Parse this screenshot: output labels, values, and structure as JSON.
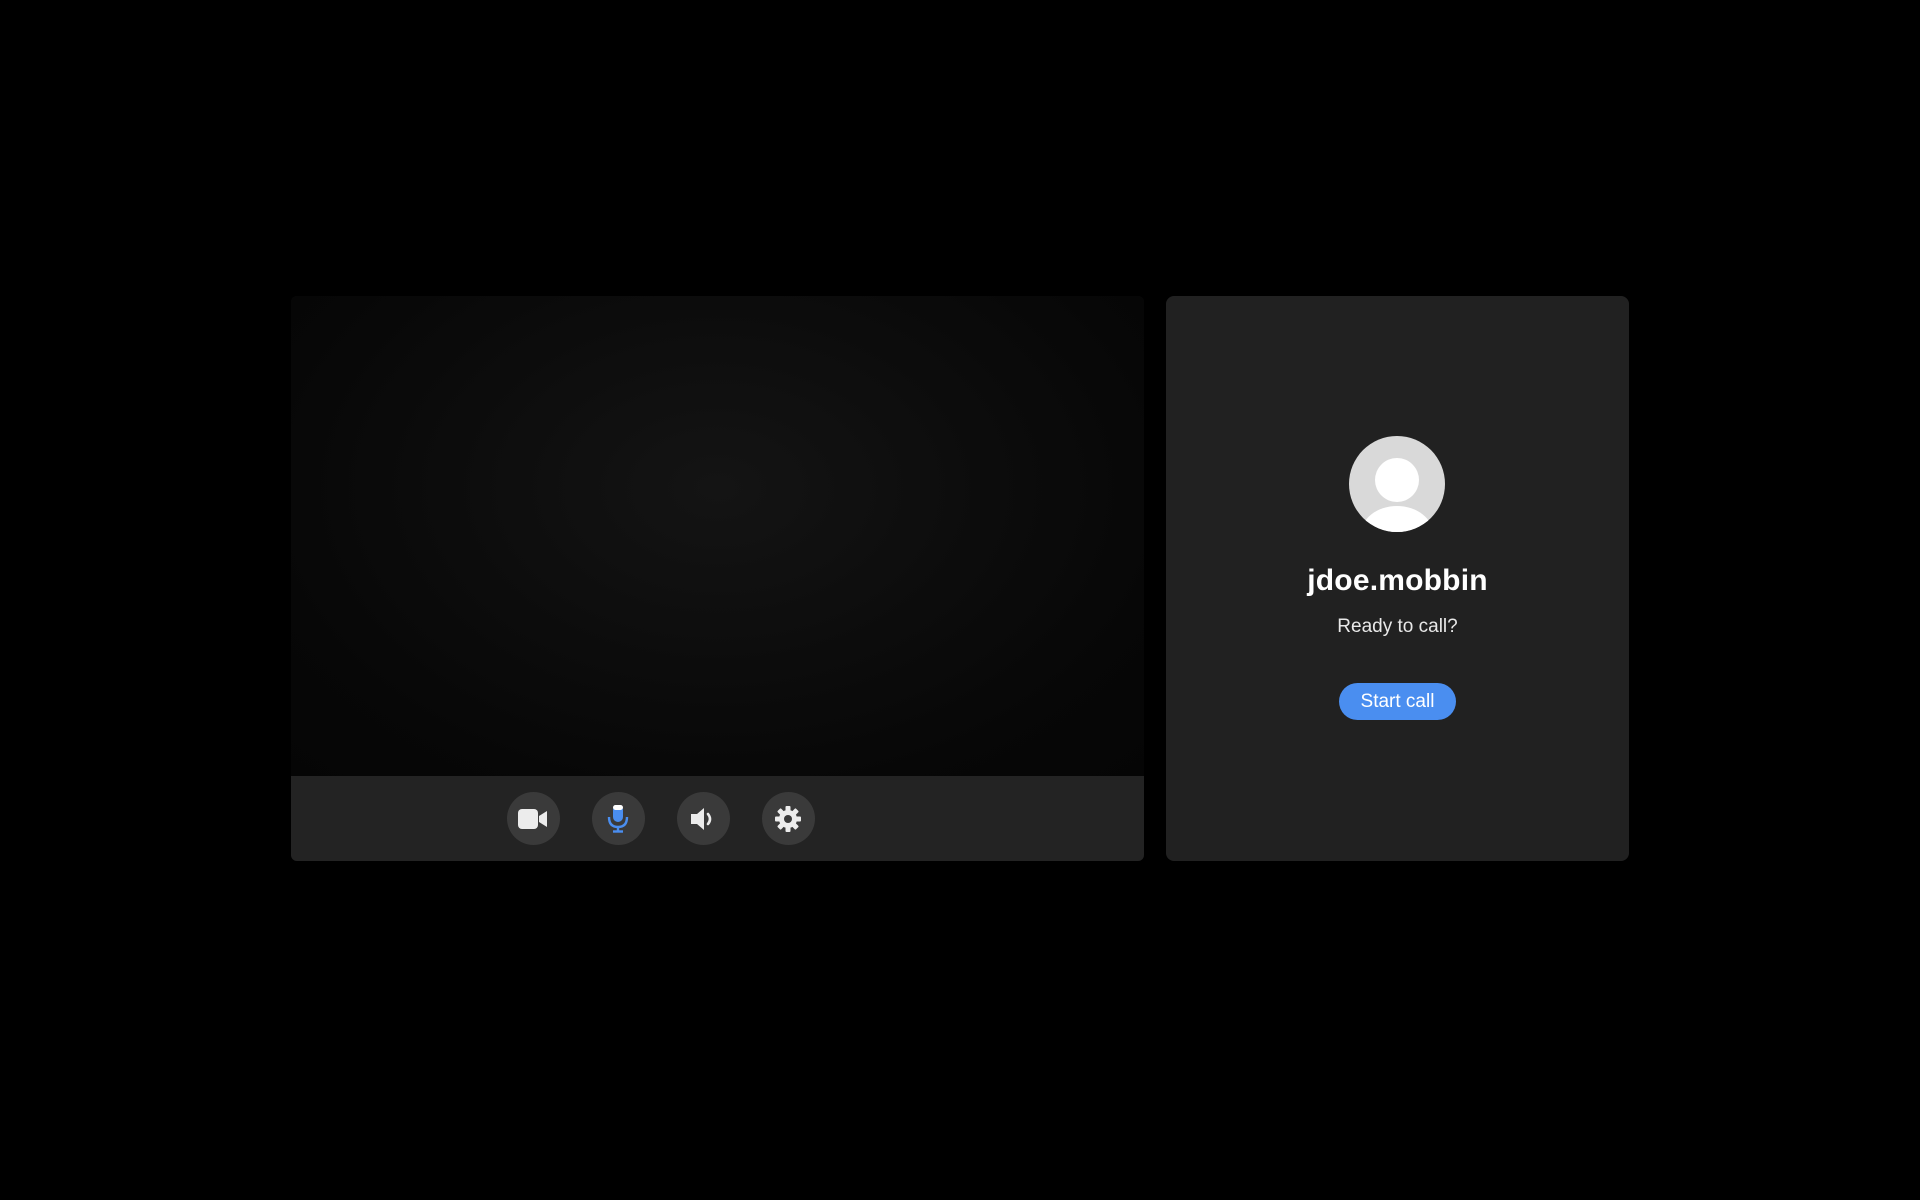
{
  "contact": {
    "name": "jdoe.mobbin",
    "status": "Ready to call?",
    "avatar_icon": "user-placeholder-icon"
  },
  "actions": {
    "start_call_label": "Start call"
  },
  "controls": [
    {
      "name": "camera",
      "icon": "video-camera-icon"
    },
    {
      "name": "microphone",
      "icon": "microphone-icon"
    },
    {
      "name": "speaker",
      "icon": "speaker-volume-icon"
    },
    {
      "name": "settings",
      "icon": "gear-icon"
    }
  ],
  "colors": {
    "background": "#000000",
    "panel": "#212121",
    "control_bar": "#232323",
    "control_button": "#3a3a3a",
    "accent": "#4a8ef0",
    "mic_active": "#4a8ef0"
  }
}
